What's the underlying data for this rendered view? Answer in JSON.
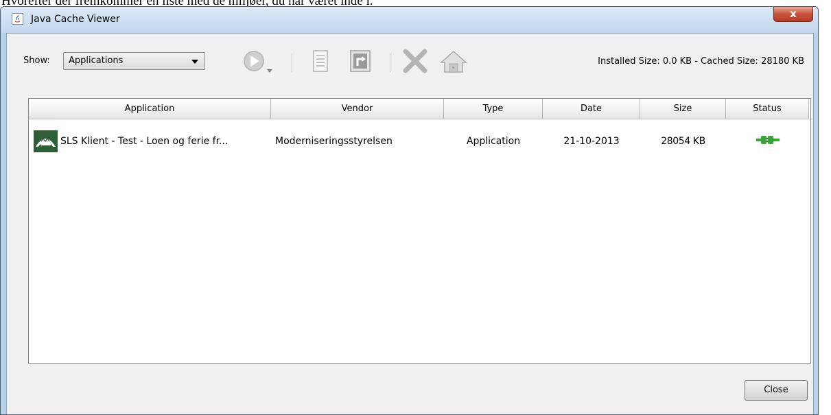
{
  "page_caption": "Hvorefter der fremkommer en liste med de miljøer, du har været inde i.",
  "window": {
    "title": "Java Cache Viewer",
    "close_glyph": "x"
  },
  "toolbar": {
    "show_label": "Show:",
    "show_value": "Applications",
    "size_info": "Installed Size:  0.0 KB - Cached Size:  28180 KB"
  },
  "table": {
    "columns": [
      "Application",
      "Vendor",
      "Type",
      "Date",
      "Size",
      "Status"
    ],
    "rows": [
      {
        "application": "SLS Klient - Test - Loen og ferie fr...",
        "vendor": "Moderniseringsstyrelsen",
        "type": "Application",
        "date": "21-10-2013",
        "size": "28054 KB",
        "status_icon": "plug-connected-icon"
      }
    ]
  },
  "footer": {
    "close_label": "Close"
  },
  "colors": {
    "status_green": "#3aa33a",
    "row_icon_bg": "#2e5e35"
  }
}
